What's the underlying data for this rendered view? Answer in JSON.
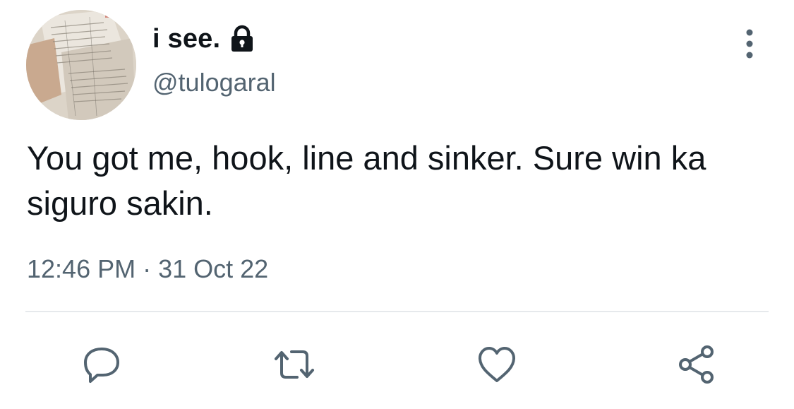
{
  "tweet": {
    "display_name": "i see.",
    "handle": "@tulogaral",
    "text": "You got me, hook, line and sinker. Sure win ka siguro sakin.",
    "time": "12:46 PM",
    "separator": "·",
    "date": "31 Oct 22",
    "protected": true
  },
  "icons": {
    "lock": "lock-icon",
    "more": "more-vertical-icon",
    "reply": "reply-icon",
    "retweet": "retweet-icon",
    "like": "heart-icon",
    "share": "share-icon"
  },
  "colors": {
    "text_primary": "#0f1419",
    "text_secondary": "#536471",
    "icon": "#536471",
    "divider": "#e6e9ec"
  }
}
